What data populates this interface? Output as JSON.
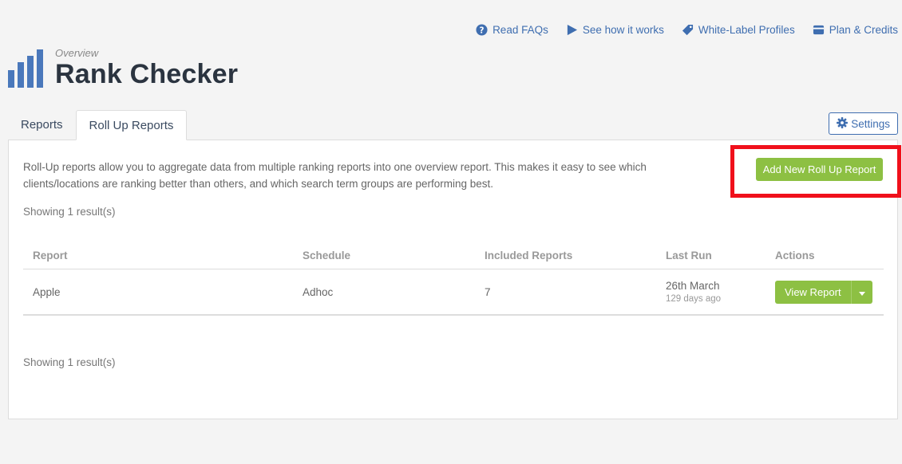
{
  "top_links": [
    {
      "label": "Read FAQs",
      "icon": "question-circle-icon"
    },
    {
      "label": "See how it works",
      "icon": "play-icon"
    },
    {
      "label": "White-Label Profiles",
      "icon": "tag-icon"
    },
    {
      "label": "Plan & Credits",
      "icon": "credit-card-icon"
    }
  ],
  "header": {
    "overview": "Overview",
    "title": "Rank Checker"
  },
  "tabs": [
    {
      "label": "Reports"
    },
    {
      "label": "Roll Up Reports"
    }
  ],
  "settings_label": "Settings",
  "intro": "Roll-Up reports allow you to aggregate data from multiple ranking reports into one overview report. This makes it easy to see which clients/locations are ranking better than others, and which search term groups are performing best.",
  "add_button_label": "Add New Roll Up Report",
  "showing_top": "Showing 1 result(s)",
  "showing_bottom": "Showing 1 result(s)",
  "table": {
    "headers": [
      "Report",
      "Schedule",
      "Included Reports",
      "Last Run",
      "Actions"
    ],
    "rows": [
      {
        "report": "Apple",
        "schedule": "Adhoc",
        "included": "7",
        "last_run": "26th March",
        "last_run_ago": "129 days ago",
        "action_label": "View Report"
      }
    ]
  },
  "colors": {
    "accent_blue": "#3f6eb0",
    "button_green": "#8dc043",
    "highlight_red": "#f0101b"
  }
}
